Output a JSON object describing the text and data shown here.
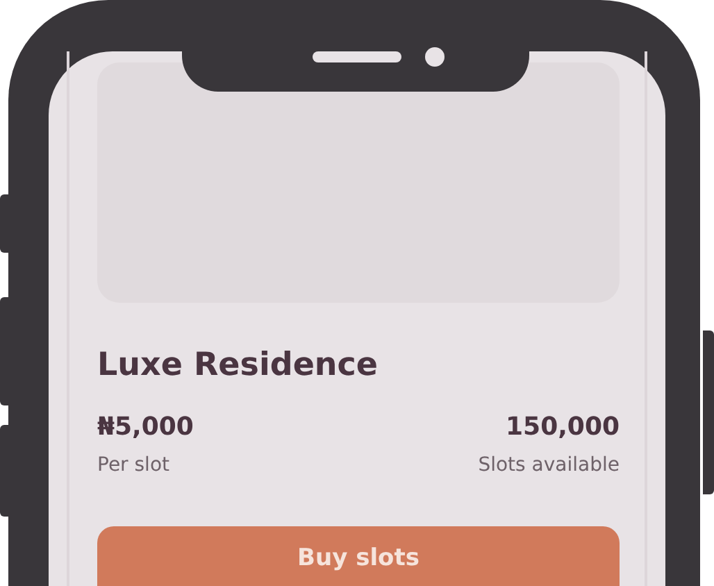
{
  "listing": {
    "title": "Luxe Residence",
    "price": "₦5,000",
    "price_label": "Per slot",
    "slots": "150,000",
    "slots_label": "Slots available"
  },
  "button": {
    "label": "Buy slots"
  }
}
